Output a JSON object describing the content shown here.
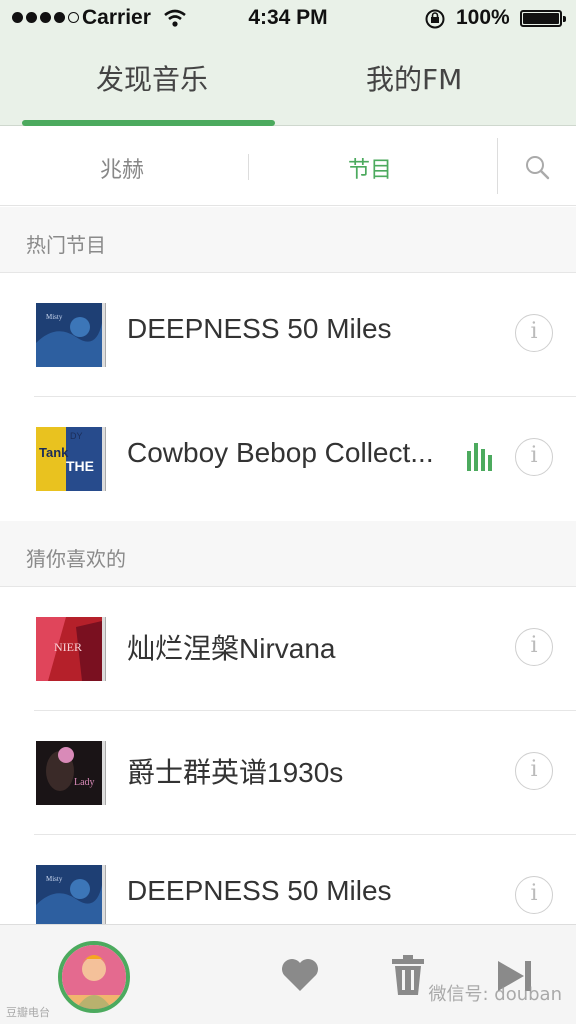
{
  "status_bar": {
    "carrier": "Carrier",
    "time": "4:34 PM",
    "battery": "100%",
    "signal_bars_filled": 4,
    "signal_bars_total": 5
  },
  "top_tabs": [
    {
      "label": "发现音乐",
      "active": true
    },
    {
      "label": "我的FM",
      "active": false
    }
  ],
  "sub_tabs": [
    {
      "label": "兆赫",
      "active": false
    },
    {
      "label": "节目",
      "active": true
    }
  ],
  "sections": [
    {
      "title": "热门节目",
      "items": [
        {
          "title": "DEEPNESS 50 Miles",
          "cover_icon": "album-cover-blue",
          "playing": false
        },
        {
          "title": "Cowboy Bebop Collect...",
          "cover_icon": "album-cover-cowboy-bebop",
          "playing": true
        }
      ]
    },
    {
      "title": "猜你喜欢的",
      "items": [
        {
          "title": "灿烂涅槃Nirvana",
          "cover_icon": "album-cover-red",
          "playing": false
        },
        {
          "title": "爵士群英谱1930s",
          "cover_icon": "album-cover-jazz",
          "playing": false
        },
        {
          "title": "DEEPNESS 50 Miles",
          "cover_icon": "album-cover-blue",
          "playing": false
        }
      ]
    }
  ],
  "player": {
    "cover_icon": "now-playing-cover",
    "watermark": "微信号: douban",
    "watermark_left": "豆瓣电台"
  },
  "colors": {
    "accent": "#4caa5e",
    "header_bg": "#e9f1e8"
  }
}
